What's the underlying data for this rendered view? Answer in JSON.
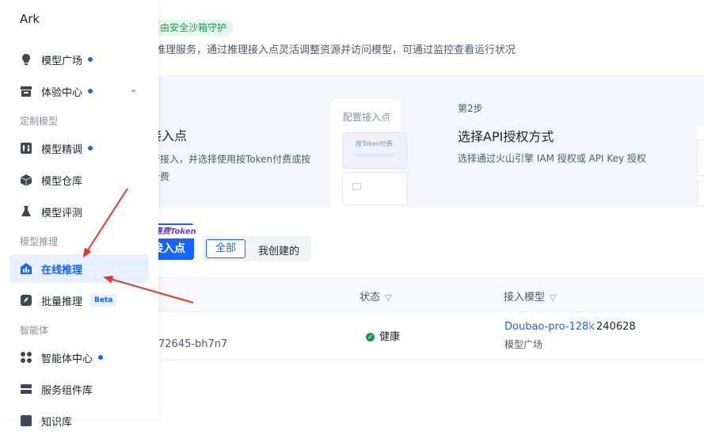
{
  "app": {
    "name": "Ark"
  },
  "sidebar": {
    "items": [
      {
        "label": "模型广场",
        "badge": true
      },
      {
        "label": "体验中心",
        "badge": true,
        "chevron": "⌄"
      },
      {
        "label": "模型精调",
        "badge": true
      },
      {
        "label": "模型仓库",
        "badge": false
      },
      {
        "label": "模型评测",
        "badge": false
      },
      {
        "label": "在线推理",
        "badge": false,
        "active": true
      },
      {
        "label": "批量推理",
        "badge": false,
        "tag": "Beta"
      },
      {
        "label": "智能体中心",
        "badge": true
      },
      {
        "label": "服务组件库",
        "badge": false
      },
      {
        "label": "知识库",
        "badge": false
      }
    ],
    "sections": [
      "定制模型",
      "模型推理",
      "智能体"
    ]
  },
  "header": {
    "sandbox_badge": "由安全沙箱守护",
    "description": "推理服务，通过推理接入点灵活调整资源并访问模型，可通过监控查看运行状况"
  },
  "guide": {
    "step1": {
      "title": "接入点",
      "text": "行接入，并选择使用按Token付费或按计费"
    },
    "config_card": {
      "title": "配置接入点",
      "option": "按Token付费"
    },
    "step2": {
      "label": "第2步",
      "title": "选择API授权方式",
      "text": "选择通过火山引擎 IAM 授权或 API Key 授权"
    }
  },
  "actions": {
    "create_label": "接入点",
    "promo_tag": "惠费Token",
    "filters": [
      "全部",
      "我创建的"
    ]
  },
  "table": {
    "columns": {
      "status": "状态",
      "model": "接入模型"
    },
    "rows": [
      {
        "id": "72645-bh7n7",
        "status": "健康",
        "model_name": "Doubao-pro-128k",
        "model_version": "240628",
        "model_source": "模型广场"
      }
    ]
  },
  "colors": {
    "accent": "#1664ff",
    "healthy": "#1a9c4c",
    "annotation": "#e23b2e"
  }
}
